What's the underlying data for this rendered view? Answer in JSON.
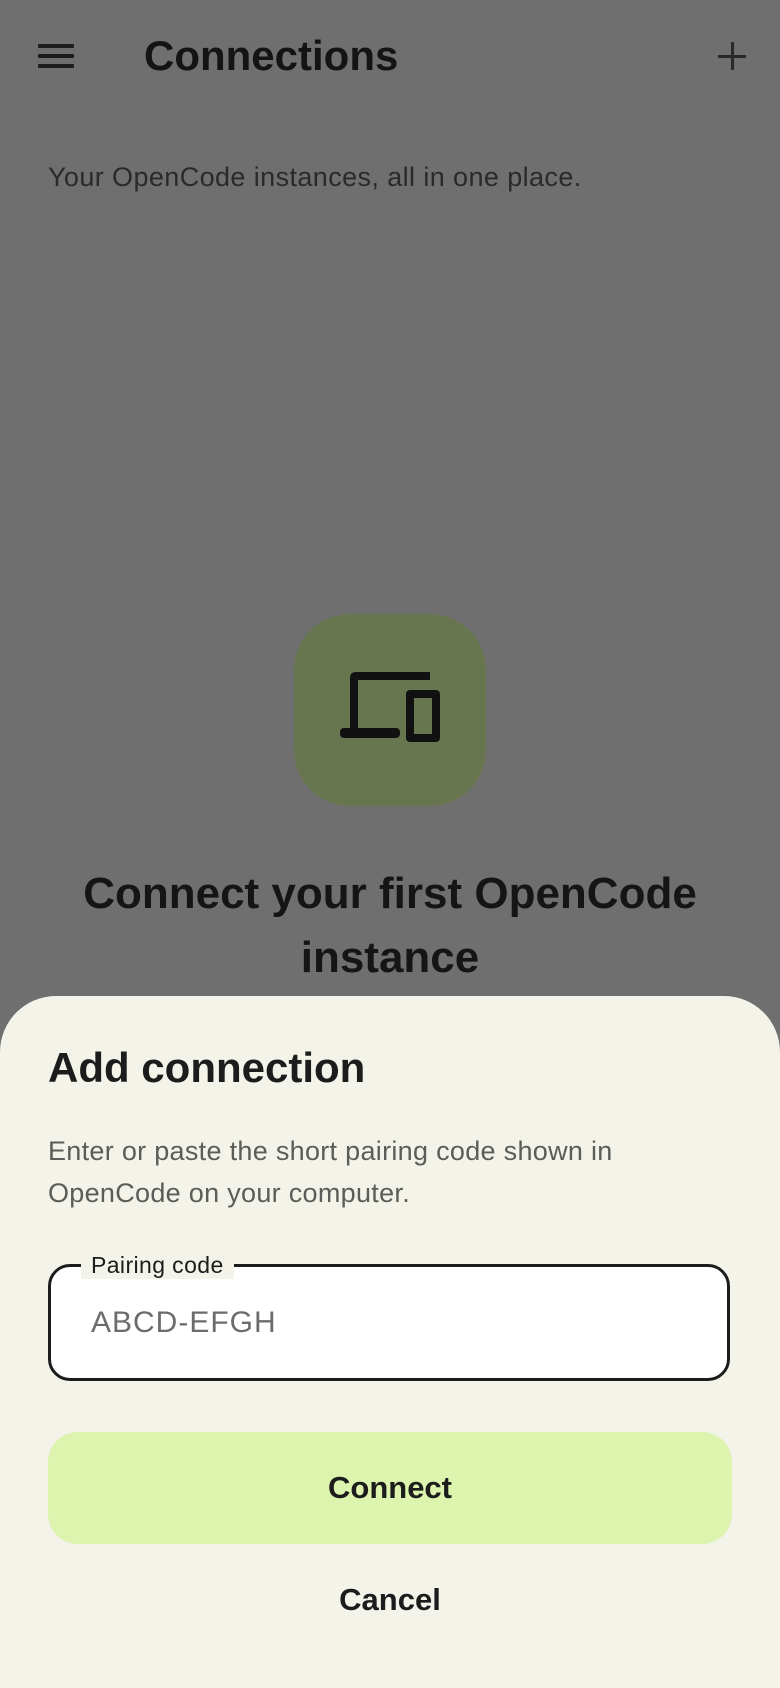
{
  "app_bar": {
    "title": "Connections",
    "menu_icon": "hamburger-menu-icon",
    "add_icon": "plus-icon"
  },
  "subtitle": "Your OpenCode instances, all in one place.",
  "empty_state": {
    "icon": "devices-icon",
    "title": "Connect your first OpenCode instance"
  },
  "sheet": {
    "title": "Add connection",
    "description": "Enter or paste the short pairing code shown in OpenCode on your computer.",
    "pairing_field": {
      "label": "Pairing code",
      "placeholder": "ABCD-EFGH",
      "value": ""
    },
    "connect_label": "Connect",
    "cancel_label": "Cancel"
  },
  "colors": {
    "scrim": "#6f6f6f",
    "sheet_background": "#f3f3e9",
    "primary_container": "#dcf4ad",
    "icon_container": "#687650",
    "on_surface": "#1c1c1c"
  }
}
